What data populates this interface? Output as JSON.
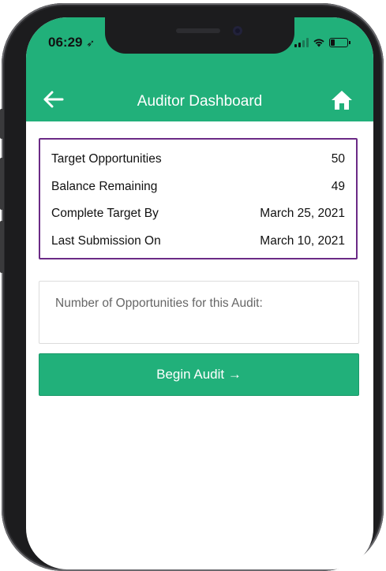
{
  "status_bar": {
    "time": "06:29",
    "location_glyph": "➶",
    "signal_icon": "cellular-signal-icon",
    "wifi_icon": "wifi-icon",
    "battery_icon": "battery-icon"
  },
  "app_bar": {
    "title": "Auditor Dashboard",
    "back_icon": "back-arrow-icon",
    "home_icon": "home-icon",
    "color": "#21b07a"
  },
  "summary": {
    "border_color": "#6b2a86",
    "rows": [
      {
        "label": "Target Opportunities",
        "value": "50"
      },
      {
        "label": "Balance Remaining",
        "value": "49"
      },
      {
        "label": "Complete Target By",
        "value": "March 25, 2021"
      },
      {
        "label": "Last Submission On",
        "value": "March 10, 2021"
      }
    ]
  },
  "opportunities_input": {
    "placeholder": "Number of Opportunities for this Audit:",
    "value": ""
  },
  "begin_button": {
    "label": "Begin Audit →",
    "color": "#21b07a"
  }
}
